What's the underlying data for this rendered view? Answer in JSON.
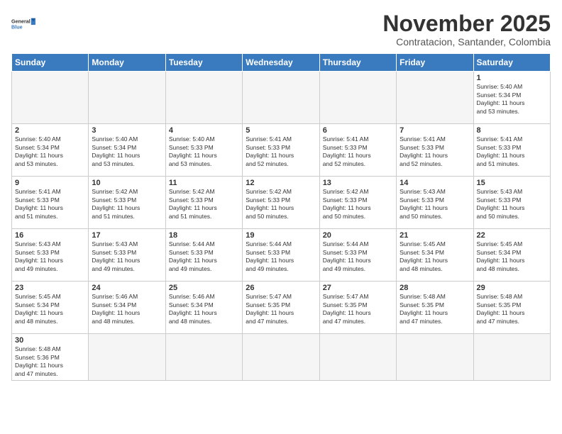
{
  "header": {
    "logo_general": "General",
    "logo_blue": "Blue",
    "month_title": "November 2025",
    "subtitle": "Contratacion, Santander, Colombia"
  },
  "days_of_week": [
    "Sunday",
    "Monday",
    "Tuesday",
    "Wednesday",
    "Thursday",
    "Friday",
    "Saturday"
  ],
  "weeks": [
    [
      {
        "day": "",
        "info": ""
      },
      {
        "day": "",
        "info": ""
      },
      {
        "day": "",
        "info": ""
      },
      {
        "day": "",
        "info": ""
      },
      {
        "day": "",
        "info": ""
      },
      {
        "day": "",
        "info": ""
      },
      {
        "day": "1",
        "info": "Sunrise: 5:40 AM\nSunset: 5:34 PM\nDaylight: 11 hours\nand 53 minutes."
      }
    ],
    [
      {
        "day": "2",
        "info": "Sunrise: 5:40 AM\nSunset: 5:34 PM\nDaylight: 11 hours\nand 53 minutes."
      },
      {
        "day": "3",
        "info": "Sunrise: 5:40 AM\nSunset: 5:34 PM\nDaylight: 11 hours\nand 53 minutes."
      },
      {
        "day": "4",
        "info": "Sunrise: 5:40 AM\nSunset: 5:33 PM\nDaylight: 11 hours\nand 53 minutes."
      },
      {
        "day": "5",
        "info": "Sunrise: 5:41 AM\nSunset: 5:33 PM\nDaylight: 11 hours\nand 52 minutes."
      },
      {
        "day": "6",
        "info": "Sunrise: 5:41 AM\nSunset: 5:33 PM\nDaylight: 11 hours\nand 52 minutes."
      },
      {
        "day": "7",
        "info": "Sunrise: 5:41 AM\nSunset: 5:33 PM\nDaylight: 11 hours\nand 52 minutes."
      },
      {
        "day": "8",
        "info": "Sunrise: 5:41 AM\nSunset: 5:33 PM\nDaylight: 11 hours\nand 51 minutes."
      }
    ],
    [
      {
        "day": "9",
        "info": "Sunrise: 5:41 AM\nSunset: 5:33 PM\nDaylight: 11 hours\nand 51 minutes."
      },
      {
        "day": "10",
        "info": "Sunrise: 5:42 AM\nSunset: 5:33 PM\nDaylight: 11 hours\nand 51 minutes."
      },
      {
        "day": "11",
        "info": "Sunrise: 5:42 AM\nSunset: 5:33 PM\nDaylight: 11 hours\nand 51 minutes."
      },
      {
        "day": "12",
        "info": "Sunrise: 5:42 AM\nSunset: 5:33 PM\nDaylight: 11 hours\nand 50 minutes."
      },
      {
        "day": "13",
        "info": "Sunrise: 5:42 AM\nSunset: 5:33 PM\nDaylight: 11 hours\nand 50 minutes."
      },
      {
        "day": "14",
        "info": "Sunrise: 5:43 AM\nSunset: 5:33 PM\nDaylight: 11 hours\nand 50 minutes."
      },
      {
        "day": "15",
        "info": "Sunrise: 5:43 AM\nSunset: 5:33 PM\nDaylight: 11 hours\nand 50 minutes."
      }
    ],
    [
      {
        "day": "16",
        "info": "Sunrise: 5:43 AM\nSunset: 5:33 PM\nDaylight: 11 hours\nand 49 minutes."
      },
      {
        "day": "17",
        "info": "Sunrise: 5:43 AM\nSunset: 5:33 PM\nDaylight: 11 hours\nand 49 minutes."
      },
      {
        "day": "18",
        "info": "Sunrise: 5:44 AM\nSunset: 5:33 PM\nDaylight: 11 hours\nand 49 minutes."
      },
      {
        "day": "19",
        "info": "Sunrise: 5:44 AM\nSunset: 5:33 PM\nDaylight: 11 hours\nand 49 minutes."
      },
      {
        "day": "20",
        "info": "Sunrise: 5:44 AM\nSunset: 5:33 PM\nDaylight: 11 hours\nand 49 minutes."
      },
      {
        "day": "21",
        "info": "Sunrise: 5:45 AM\nSunset: 5:34 PM\nDaylight: 11 hours\nand 48 minutes."
      },
      {
        "day": "22",
        "info": "Sunrise: 5:45 AM\nSunset: 5:34 PM\nDaylight: 11 hours\nand 48 minutes."
      }
    ],
    [
      {
        "day": "23",
        "info": "Sunrise: 5:45 AM\nSunset: 5:34 PM\nDaylight: 11 hours\nand 48 minutes."
      },
      {
        "day": "24",
        "info": "Sunrise: 5:46 AM\nSunset: 5:34 PM\nDaylight: 11 hours\nand 48 minutes."
      },
      {
        "day": "25",
        "info": "Sunrise: 5:46 AM\nSunset: 5:34 PM\nDaylight: 11 hours\nand 48 minutes."
      },
      {
        "day": "26",
        "info": "Sunrise: 5:47 AM\nSunset: 5:35 PM\nDaylight: 11 hours\nand 47 minutes."
      },
      {
        "day": "27",
        "info": "Sunrise: 5:47 AM\nSunset: 5:35 PM\nDaylight: 11 hours\nand 47 minutes."
      },
      {
        "day": "28",
        "info": "Sunrise: 5:48 AM\nSunset: 5:35 PM\nDaylight: 11 hours\nand 47 minutes."
      },
      {
        "day": "29",
        "info": "Sunrise: 5:48 AM\nSunset: 5:35 PM\nDaylight: 11 hours\nand 47 minutes."
      }
    ],
    [
      {
        "day": "30",
        "info": "Sunrise: 5:48 AM\nSunset: 5:36 PM\nDaylight: 11 hours\nand 47 minutes."
      },
      {
        "day": "",
        "info": ""
      },
      {
        "day": "",
        "info": ""
      },
      {
        "day": "",
        "info": ""
      },
      {
        "day": "",
        "info": ""
      },
      {
        "day": "",
        "info": ""
      },
      {
        "day": "",
        "info": ""
      }
    ]
  ]
}
